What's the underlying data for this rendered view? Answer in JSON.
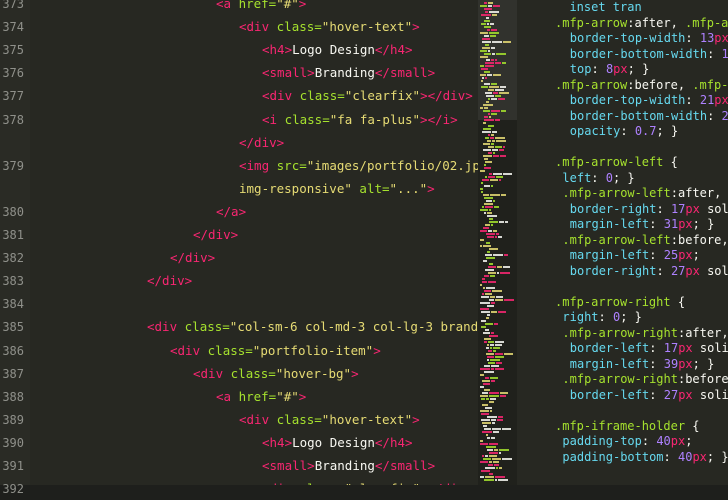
{
  "colors": {
    "background": "#272822",
    "tag": "#f92672",
    "attribute": "#a6e22e",
    "string": "#e6db74",
    "text": "#f8f8f2",
    "property": "#66d9ef",
    "number": "#ae81ff",
    "line_number": "#8f908a"
  },
  "left_editor": {
    "language": "html",
    "lines": [
      {
        "num": "373",
        "indent": 8,
        "tokens": [
          {
            "t": "tag",
            "v": "<a "
          },
          {
            "t": "attr",
            "v": "href="
          },
          {
            "t": "str",
            "v": "\"#\""
          },
          {
            "t": "tag",
            "v": ">"
          }
        ]
      },
      {
        "num": "374",
        "indent": 10,
        "tokens": [
          {
            "t": "tag",
            "v": "<div "
          },
          {
            "t": "attr",
            "v": "class="
          },
          {
            "t": "str",
            "v": "\"hover-text\""
          },
          {
            "t": "tag",
            "v": ">"
          }
        ]
      },
      {
        "num": "375",
        "indent": 12,
        "tokens": [
          {
            "t": "tag",
            "v": "<h4>"
          },
          {
            "t": "txt",
            "v": "Logo Design"
          },
          {
            "t": "tag",
            "v": "</h4>"
          }
        ]
      },
      {
        "num": "376",
        "indent": 12,
        "tokens": [
          {
            "t": "tag",
            "v": "<small>"
          },
          {
            "t": "txt",
            "v": "Branding"
          },
          {
            "t": "tag",
            "v": "</small>"
          }
        ]
      },
      {
        "num": "377",
        "indent": 12,
        "tokens": [
          {
            "t": "tag",
            "v": "<div "
          },
          {
            "t": "attr",
            "v": "class="
          },
          {
            "t": "str",
            "v": "\"clearfix\""
          },
          {
            "t": "tag",
            "v": "></div>"
          }
        ]
      },
      {
        "num": "378",
        "indent": 12,
        "tokens": [
          {
            "t": "tag",
            "v": "<i "
          },
          {
            "t": "attr",
            "v": "class="
          },
          {
            "t": "str",
            "v": "\"fa fa-plus\""
          },
          {
            "t": "tag",
            "v": "></i>"
          }
        ]
      },
      {
        "num": "",
        "indent": 10,
        "tokens": [
          {
            "t": "tag",
            "v": "</div>"
          }
        ]
      },
      {
        "num": "379",
        "indent": 10,
        "tokens": [
          {
            "t": "tag",
            "v": "<img "
          },
          {
            "t": "attr",
            "v": "src="
          },
          {
            "t": "str",
            "v": "\"images/portfolio/02.jpg\""
          },
          {
            "t": "txt",
            "v": " "
          },
          {
            "t": "attr",
            "v": "class="
          },
          {
            "t": "str",
            "v": "\""
          }
        ]
      },
      {
        "num": "",
        "indent": 10,
        "tokens": [
          {
            "t": "str",
            "v": "img-responsive\""
          },
          {
            "t": "txt",
            "v": " "
          },
          {
            "t": "attr",
            "v": "alt="
          },
          {
            "t": "str",
            "v": "\"...\""
          },
          {
            "t": "tag",
            "v": ">"
          }
        ]
      },
      {
        "num": "380",
        "indent": 8,
        "tokens": [
          {
            "t": "tag",
            "v": "</a>"
          }
        ]
      },
      {
        "num": "381",
        "indent": 6,
        "tokens": [
          {
            "t": "tag",
            "v": "</div>"
          }
        ]
      },
      {
        "num": "382",
        "indent": 4,
        "tokens": [
          {
            "t": "tag",
            "v": "</div>"
          }
        ]
      },
      {
        "num": "383",
        "indent": 2,
        "tokens": [
          {
            "t": "tag",
            "v": "</div>"
          }
        ]
      },
      {
        "num": "384",
        "indent": 0,
        "tokens": []
      },
      {
        "num": "385",
        "indent": 2,
        "tokens": [
          {
            "t": "tag",
            "v": "<div "
          },
          {
            "t": "attr",
            "v": "class="
          },
          {
            "t": "str",
            "v": "\"col-sm-6 col-md-3 col-lg-3 branding\""
          },
          {
            "t": "tag",
            "v": ">"
          }
        ]
      },
      {
        "num": "386",
        "indent": 4,
        "tokens": [
          {
            "t": "tag",
            "v": "<div "
          },
          {
            "t": "attr",
            "v": "class="
          },
          {
            "t": "str",
            "v": "\"portfolio-item\""
          },
          {
            "t": "tag",
            "v": ">"
          }
        ]
      },
      {
        "num": "387",
        "indent": 6,
        "tokens": [
          {
            "t": "tag",
            "v": "<div "
          },
          {
            "t": "attr",
            "v": "class="
          },
          {
            "t": "str",
            "v": "\"hover-bg\""
          },
          {
            "t": "tag",
            "v": ">"
          }
        ]
      },
      {
        "num": "388",
        "indent": 8,
        "tokens": [
          {
            "t": "tag",
            "v": "<a "
          },
          {
            "t": "attr",
            "v": "href="
          },
          {
            "t": "str",
            "v": "\"#\""
          },
          {
            "t": "tag",
            "v": ">"
          }
        ]
      },
      {
        "num": "389",
        "indent": 10,
        "tokens": [
          {
            "t": "tag",
            "v": "<div "
          },
          {
            "t": "attr",
            "v": "class="
          },
          {
            "t": "str",
            "v": "\"hover-text\""
          },
          {
            "t": "tag",
            "v": ">"
          }
        ]
      },
      {
        "num": "390",
        "indent": 12,
        "tokens": [
          {
            "t": "tag",
            "v": "<h4>"
          },
          {
            "t": "txt",
            "v": "Logo Design"
          },
          {
            "t": "tag",
            "v": "</h4>"
          }
        ]
      },
      {
        "num": "391",
        "indent": 12,
        "tokens": [
          {
            "t": "tag",
            "v": "<small>"
          },
          {
            "t": "txt",
            "v": "Branding"
          },
          {
            "t": "tag",
            "v": "</small>"
          }
        ]
      },
      {
        "num": "392",
        "indent": 12,
        "tokens": [
          {
            "t": "tag",
            "v": "<div "
          },
          {
            "t": "attr",
            "v": "class="
          },
          {
            "t": "str",
            "v": "\"clearfix\""
          },
          {
            "t": "tag",
            "v": "></div>"
          }
        ]
      }
    ]
  },
  "right_editor": {
    "language": "css",
    "lines": [
      {
        "num": "192",
        "indent": 0,
        "tokens": [
          {
            "t": "prop",
            "v": "  inset tran"
          }
        ]
      },
      {
        "num": "193",
        "indent": 0,
        "tokens": [
          {
            "t": "sel",
            "v": ".mfp-arrow"
          },
          {
            "t": "pun",
            "v": ":after, "
          },
          {
            "t": "sel",
            "v": ".mfp-arro"
          }
        ]
      },
      {
        "num": "194",
        "indent": 2,
        "tokens": [
          {
            "t": "prop",
            "v": "border-top-width"
          },
          {
            "t": "pun",
            "v": ": "
          },
          {
            "t": "num",
            "v": "13"
          },
          {
            "t": "unit",
            "v": "px"
          },
          {
            "t": "pun",
            "v": ";"
          }
        ]
      },
      {
        "num": "195",
        "indent": 2,
        "tokens": [
          {
            "t": "prop",
            "v": "border-bottom-width"
          },
          {
            "t": "pun",
            "v": ": "
          },
          {
            "t": "num",
            "v": "13"
          },
          {
            "t": "unit",
            "v": "px"
          },
          {
            "t": "pun",
            "v": ";"
          }
        ]
      },
      {
        "num": "196",
        "indent": 2,
        "tokens": [
          {
            "t": "prop",
            "v": "top"
          },
          {
            "t": "pun",
            "v": ": "
          },
          {
            "t": "num",
            "v": "8"
          },
          {
            "t": "unit",
            "v": "px"
          },
          {
            "t": "pun",
            "v": "; }"
          }
        ]
      },
      {
        "num": "197",
        "indent": 0,
        "tokens": [
          {
            "t": "sel",
            "v": ".mfp-arrow"
          },
          {
            "t": "pun",
            "v": ":before, "
          },
          {
            "t": "sel",
            "v": ".mfp-arro"
          }
        ]
      },
      {
        "num": "198",
        "indent": 2,
        "tokens": [
          {
            "t": "prop",
            "v": "border-top-width"
          },
          {
            "t": "pun",
            "v": ": "
          },
          {
            "t": "num",
            "v": "21"
          },
          {
            "t": "unit",
            "v": "px"
          },
          {
            "t": "pun",
            "v": ";"
          }
        ]
      },
      {
        "num": "199",
        "indent": 2,
        "tokens": [
          {
            "t": "prop",
            "v": "border-bottom-width"
          },
          {
            "t": "pun",
            "v": ": "
          },
          {
            "t": "num",
            "v": "21"
          },
          {
            "t": "unit",
            "v": "px"
          },
          {
            "t": "pun",
            "v": ";"
          }
        ]
      },
      {
        "num": "200",
        "indent": 2,
        "tokens": [
          {
            "t": "prop",
            "v": "opacity"
          },
          {
            "t": "pun",
            "v": ": "
          },
          {
            "t": "num",
            "v": "0.7"
          },
          {
            "t": "pun",
            "v": "; }"
          }
        ]
      },
      {
        "num": "201",
        "indent": 0,
        "tokens": []
      },
      {
        "num": "202",
        "indent": 0,
        "tokens": [
          {
            "t": "sel",
            "v": ".mfp-arrow-left"
          },
          {
            "t": "pun",
            "v": " {"
          }
        ]
      },
      {
        "num": "203",
        "indent": 1,
        "tokens": [
          {
            "t": "prop",
            "v": "left"
          },
          {
            "t": "pun",
            "v": ": "
          },
          {
            "t": "num",
            "v": "0"
          },
          {
            "t": "pun",
            "v": "; }"
          }
        ]
      },
      {
        "num": "204",
        "indent": 1,
        "tokens": [
          {
            "t": "sel",
            "v": ".mfp-arrow-left"
          },
          {
            "t": "pun",
            "v": ":after, "
          },
          {
            "t": "sel",
            "v": ".mf"
          }
        ]
      },
      {
        "num": "205",
        "indent": 2,
        "tokens": [
          {
            "t": "prop",
            "v": "border-right"
          },
          {
            "t": "pun",
            "v": ": "
          },
          {
            "t": "num",
            "v": "17"
          },
          {
            "t": "unit",
            "v": "px"
          },
          {
            "t": "pun",
            "v": " solid #"
          }
        ]
      },
      {
        "num": "206",
        "indent": 2,
        "tokens": [
          {
            "t": "prop",
            "v": "margin-left"
          },
          {
            "t": "pun",
            "v": ": "
          },
          {
            "t": "num",
            "v": "31"
          },
          {
            "t": "unit",
            "v": "px"
          },
          {
            "t": "pun",
            "v": "; }"
          }
        ]
      },
      {
        "num": "207",
        "indent": 1,
        "tokens": [
          {
            "t": "sel",
            "v": ".mfp-arrow-left"
          },
          {
            "t": "pun",
            "v": ":before, "
          },
          {
            "t": "sel",
            "v": ".mf"
          }
        ]
      },
      {
        "num": "208",
        "indent": 2,
        "tokens": [
          {
            "t": "prop",
            "v": "margin-left"
          },
          {
            "t": "pun",
            "v": ": "
          },
          {
            "t": "num",
            "v": "25"
          },
          {
            "t": "unit",
            "v": "px"
          },
          {
            "t": "pun",
            "v": ";"
          }
        ]
      },
      {
        "num": "209",
        "indent": 2,
        "tokens": [
          {
            "t": "prop",
            "v": "border-right"
          },
          {
            "t": "pun",
            "v": ": "
          },
          {
            "t": "num",
            "v": "27"
          },
          {
            "t": "unit",
            "v": "px"
          },
          {
            "t": "pun",
            "v": " solid #"
          }
        ]
      },
      {
        "num": "210",
        "indent": 0,
        "tokens": []
      },
      {
        "num": "211",
        "indent": 0,
        "tokens": [
          {
            "t": "sel",
            "v": ".mfp-arrow-right"
          },
          {
            "t": "pun",
            "v": " {"
          }
        ]
      },
      {
        "num": "212",
        "indent": 1,
        "tokens": [
          {
            "t": "prop",
            "v": "right"
          },
          {
            "t": "pun",
            "v": ": "
          },
          {
            "t": "num",
            "v": "0"
          },
          {
            "t": "pun",
            "v": "; }"
          }
        ]
      },
      {
        "num": "213",
        "indent": 1,
        "tokens": [
          {
            "t": "sel",
            "v": ".mfp-arrow-right"
          },
          {
            "t": "pun",
            "v": ":after, "
          },
          {
            "t": "sel",
            "v": ".mf"
          }
        ]
      },
      {
        "num": "214",
        "indent": 2,
        "tokens": [
          {
            "t": "prop",
            "v": "border-left"
          },
          {
            "t": "pun",
            "v": ": "
          },
          {
            "t": "num",
            "v": "17"
          },
          {
            "t": "unit",
            "v": "px"
          },
          {
            "t": "pun",
            "v": " solid #F"
          }
        ]
      },
      {
        "num": "215",
        "indent": 2,
        "tokens": [
          {
            "t": "prop",
            "v": "margin-left"
          },
          {
            "t": "pun",
            "v": ": "
          },
          {
            "t": "num",
            "v": "39"
          },
          {
            "t": "unit",
            "v": "px"
          },
          {
            "t": "pun",
            "v": "; }"
          }
        ]
      },
      {
        "num": "216",
        "indent": 1,
        "tokens": [
          {
            "t": "sel",
            "v": ".mfp-arrow-right"
          },
          {
            "t": "pun",
            "v": ":before, "
          },
          {
            "t": "sel",
            "v": ".mf"
          }
        ]
      },
      {
        "num": "217",
        "indent": 2,
        "tokens": [
          {
            "t": "prop",
            "v": "border-left"
          },
          {
            "t": "pun",
            "v": ": "
          },
          {
            "t": "num",
            "v": "27"
          },
          {
            "t": "unit",
            "v": "px"
          },
          {
            "t": "pun",
            "v": " solid #3"
          }
        ]
      },
      {
        "num": "218",
        "indent": 0,
        "tokens": []
      },
      {
        "num": "219",
        "indent": 0,
        "tokens": [
          {
            "t": "sel",
            "v": ".mfp-iframe-holder"
          },
          {
            "t": "pun",
            "v": " {"
          }
        ]
      },
      {
        "num": "220",
        "indent": 1,
        "tokens": [
          {
            "t": "prop",
            "v": "padding-top"
          },
          {
            "t": "pun",
            "v": ": "
          },
          {
            "t": "num",
            "v": "40"
          },
          {
            "t": "unit",
            "v": "px"
          },
          {
            "t": "pun",
            "v": ";"
          }
        ]
      },
      {
        "num": "221",
        "indent": 1,
        "tokens": [
          {
            "t": "prop",
            "v": "padding-bottom"
          },
          {
            "t": "pun",
            "v": ": "
          },
          {
            "t": "num",
            "v": "40"
          },
          {
            "t": "unit",
            "v": "px"
          },
          {
            "t": "pun",
            "v": "; }"
          }
        ]
      }
    ]
  }
}
